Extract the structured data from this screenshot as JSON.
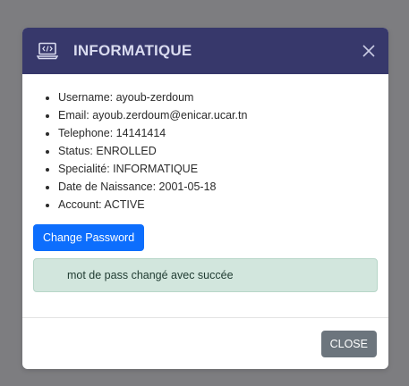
{
  "modal": {
    "title": "INFORMATIQUE",
    "header_icon": "laptop-code-icon",
    "close_icon": "close-icon",
    "colors": {
      "header_bg": "#37386b",
      "primary": "#0d6efd",
      "secondary": "#6c757d",
      "alert_bg": "#d2e6dd"
    }
  },
  "info": {
    "items": [
      "Username: ayoub-zerdoum",
      "Email: ayoub.zerdoum@enicar.ucar.tn",
      "Telephone: 14141414",
      "Status: ENROLLED",
      "Specialité: INFORMATIQUE",
      "Date de Naissance: 2001-05-18",
      "Account: ACTIVE"
    ]
  },
  "actions": {
    "change_password_label": "Change Password",
    "close_label": "CLOSE"
  },
  "alert": {
    "message": "mot de pass changé avec succée"
  }
}
